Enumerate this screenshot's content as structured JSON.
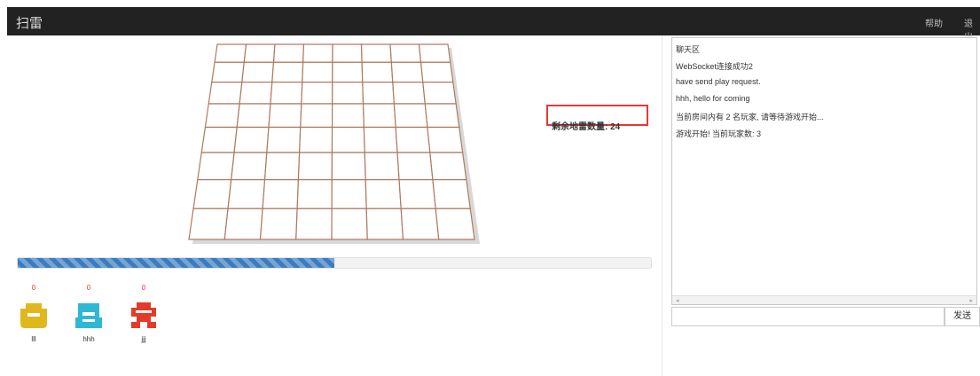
{
  "header": {
    "brand": "扫雷",
    "help_label": "帮助",
    "exit_label": "退出"
  },
  "game": {
    "grid": {
      "rows": 8,
      "cols": 8
    },
    "mines_remaining_text": "剩余地雷数量: 24",
    "progress_fraction": 0.5
  },
  "players": [
    {
      "name": "lll",
      "score": "0",
      "color": "#e0b81e"
    },
    {
      "name": "hhh",
      "score": "0",
      "color": "#2fb8d6"
    },
    {
      "name": "jjj",
      "score": "0",
      "color": "#e23b2a"
    }
  ],
  "chat": {
    "messages": [
      "聊天区",
      "WebSocket连接成功2",
      "have send play request.",
      "hhh, hello for coming",
      "当前房间内有 2 名玩家, 请等待游戏开始...",
      "游戏开始! 当前玩家数: 3"
    ],
    "send_label": "发送",
    "input_value": ""
  },
  "colors": {
    "grid_line": "#b07a5e",
    "progress": "#3b7cc0",
    "counter_border": "#e53935",
    "topbar": "#222222"
  }
}
